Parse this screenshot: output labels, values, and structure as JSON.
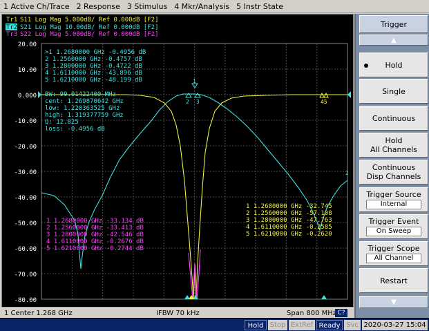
{
  "menu": [
    "1 Active Ch/Trace",
    "2 Response",
    "3 Stimulus",
    "4 Mkr/Analysis",
    "5 Instr State"
  ],
  "traces": [
    {
      "label": "Tr1",
      "text": "S11 Log Mag 5.000dB/ Ref 0.000dB [F2]",
      "color": "#f0f040"
    },
    {
      "label": "Tr2",
      "text": "S21 Log Mag 10.00dB/ Ref 0.000dB [F2]",
      "color": "#40e0e0"
    },
    {
      "label": "Tr3",
      "text": "S22 Log Mag 5.000dB/ Ref 0.000dB [F2]",
      "color": "#ff40ff"
    }
  ],
  "y_ticks": [
    "20.00",
    "10.00",
    "0.000",
    "-10.00",
    "-20.00",
    "-30.00",
    "-40.00",
    "-50.00",
    "-60.00",
    "-70.00",
    "-80.00"
  ],
  "s21_markers": [
    ">1  1.2680000 GHz -0.4956 dB",
    " 2  1.2560000 GHz -0.4757 dB",
    " 3  1.2800000 GHz -0.4722 dB",
    " 4  1.6110000 GHz -43.896 dB",
    " 5  1.6210000 GHz -48.199 dB"
  ],
  "bandwidth_stats": [
    "   BW:  99.01422400 MHz",
    "cent:   1.269870642 GHz",
    "  low:   1.220363525 GHz",
    "high:   1.319377759 GHz",
    "    Q:   12.825",
    "loss:  -0.4956 dB"
  ],
  "s11_markers": [
    "1  1.2680000  GHz -32.745",
    "2  1.2560000  GHz -57.108",
    "3  1.2800000  GHz -47.763",
    "4  1.6110000  GHz -0.2585",
    "5  1.6210000  GHz -0.2620"
  ],
  "s22_markers": [
    "1  1.2680000  GHz -33.134  dB",
    "2  1.2560000  GHz -33.413  dB",
    "3  1.2800000  GHz -42.546  dB",
    "4  1.6110000  GHz -0.2676  dB",
    "5  1.6210000  GHz -0.2744  dB"
  ],
  "status": {
    "center": "1  Center 1.268 GHz",
    "ifbw": "IFBW 70 kHz",
    "span": "Span 800 MHz",
    "cal": "C?"
  },
  "bottom": {
    "hold": "Hold",
    "stop": "Stop",
    "extref": "ExtRef",
    "ready": "Ready",
    "svc": "Svc",
    "datetime": "2020-03-27 15:04"
  },
  "softkeys": {
    "title": "Trigger",
    "hold": "Hold",
    "single": "Single",
    "continuous": "Continuous",
    "hold_all_1": "Hold",
    "hold_all_2": "All Channels",
    "cont_disp_1": "Continuous",
    "cont_disp_2": "Disp Channels",
    "source_label": "Trigger Source",
    "source_value": "Internal",
    "event_label": "Trigger Event",
    "event_value": "On Sweep",
    "scope_label": "Trigger Scope",
    "scope_value": "All Channel",
    "restart": "Restart"
  },
  "colors": {
    "s11": "#f0f040",
    "s21": "#40e0e0",
    "s22": "#ff40ff",
    "grid": "#505050"
  }
}
